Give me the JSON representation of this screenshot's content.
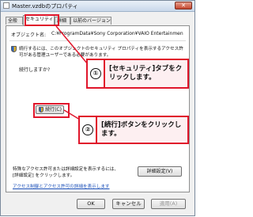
{
  "window": {
    "title": "Master.vzdbのプロパティ",
    "close_label": "✕"
  },
  "tabs": [
    {
      "label": "全般"
    },
    {
      "label": "セキュリティ"
    },
    {
      "label": "詳細"
    },
    {
      "label": "以前のバージョン"
    }
  ],
  "security": {
    "object_name_label": "オブジェクト名:",
    "object_name_value": "C:¥ProgramData¥Sony Corporation¥VAIO Entertainmen",
    "notice_line1": "続行するには、このオブジェクトのセキュリティ プロパティを表示するアクセス許",
    "notice_line2": "可がある管理ユーザーである必要があります。",
    "question": "続行しますか?",
    "continue_button": "続行(C)",
    "advanced_note_line1": "特殊なアクセス許可または詳細設定を表示するには、",
    "advanced_note_line2": "[詳細設定] をクリックします。",
    "advanced_button": "詳細設定(V)",
    "help_link": "アクセス制御とアクセス許可の詳細を表示します"
  },
  "footer": {
    "ok": "OK",
    "cancel": "キャンセル",
    "apply": "適用(A)"
  },
  "callouts": [
    {
      "number": "①",
      "text": "[セキュリティ]タブをクリックします。"
    },
    {
      "number": "②",
      "text": "[続行]ボタンをクリックします。"
    }
  ],
  "colors": {
    "highlight": "#e0162b",
    "callout_bg": "#fdeff1",
    "link": "#1a4fb8"
  }
}
